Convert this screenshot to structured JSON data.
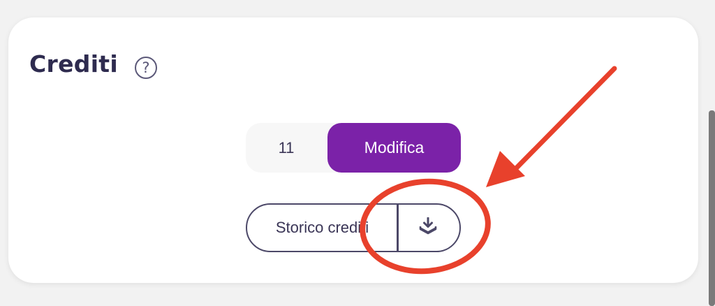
{
  "section": {
    "title": "Crediti",
    "help_icon": "?"
  },
  "credits": {
    "value": "11",
    "modify_label": "Modifica"
  },
  "history": {
    "label": "Storico crediti",
    "download_icon": "download-tray-icon"
  },
  "annotation": {
    "color": "#e8412c",
    "shapes": [
      "arrow",
      "ellipse"
    ]
  },
  "colors": {
    "accent": "#7b22a8",
    "text_dark": "#2e2b4f"
  }
}
